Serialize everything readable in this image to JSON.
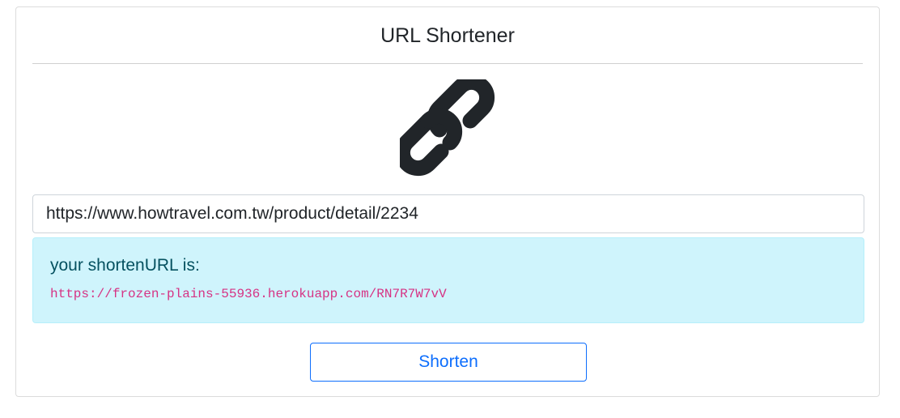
{
  "header": {
    "title": "URL Shortener"
  },
  "logo": {
    "icon": "link-icon",
    "color": "#212529"
  },
  "form": {
    "url_value": "https://www.howtravel.com.tw/product/detail/2234"
  },
  "result": {
    "label": "your shortenURL is:",
    "short_url": "https://frozen-plains-55936.herokuapp.com/RN7R7W7vV",
    "background": "#cff4fc",
    "url_color": "#d63384"
  },
  "actions": {
    "shorten_label": "Shorten",
    "accent": "#0d6efd"
  }
}
